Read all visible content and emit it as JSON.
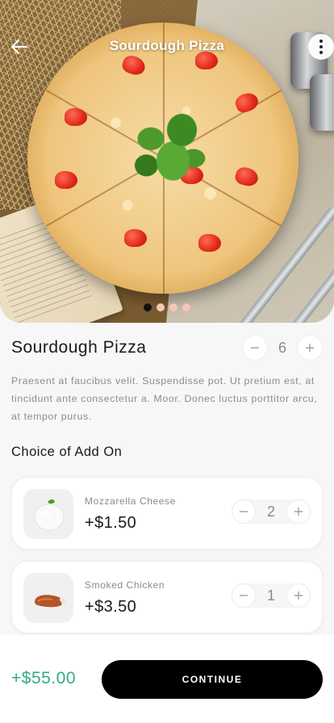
{
  "header": {
    "title": "Sourdough Pizza",
    "back_icon": "arrow-left-icon",
    "more_icon": "more-vertical-icon"
  },
  "carousel": {
    "total_slides": 4,
    "active_index": 0
  },
  "product": {
    "name": "Sourdough Pizza",
    "quantity": "6",
    "description": "Praesent at faucibus velit. Suspendisse pot. Ut  pretium est, at tincidunt ante consectetur a. Moor. Donec luctus porttitor arcu, at tempor purus."
  },
  "addons": {
    "section_title": "Choice of Add On",
    "items": [
      {
        "name": "Mozzarella Cheese",
        "price": "+$1.50",
        "quantity": "2"
      },
      {
        "name": "Smoked Chicken",
        "price": "+$3.50",
        "quantity": "1"
      }
    ]
  },
  "footer": {
    "total": "+$55.00",
    "continue_label": "CONTINUE"
  },
  "colors": {
    "accent_green": "#2fae7d",
    "button_black": "#000000",
    "dot_inactive": "#f4c6b6"
  }
}
